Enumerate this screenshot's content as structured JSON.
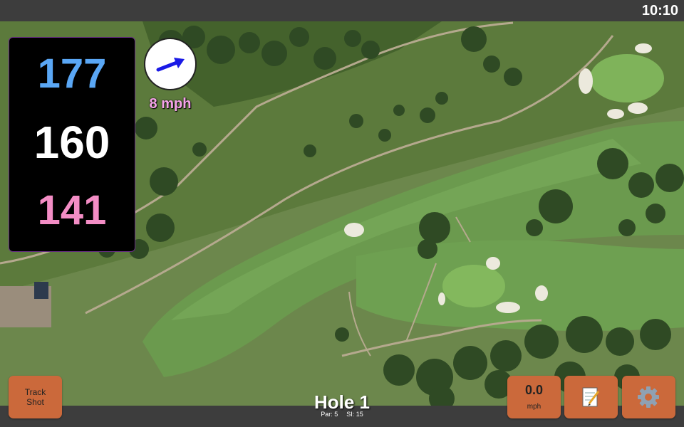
{
  "status_bar": {
    "time": "10:10"
  },
  "distances": {
    "back": "177",
    "middle": "160",
    "front": "141"
  },
  "wind": {
    "speed_label": "8 mph",
    "direction": "east-northeast"
  },
  "hole": {
    "title": "Hole 1",
    "par_label": "Par: 5",
    "si_label": "SI: 15"
  },
  "buttons": {
    "track_shot_line1": "Track",
    "track_shot_line2": "Shot",
    "wind_value": "0.0",
    "wind_unit": "mph",
    "notes_icon": "notepad-icon",
    "settings_icon": "gear-icon"
  },
  "colors": {
    "back_distance": "#5aa7f5",
    "middle_distance": "#ffffff",
    "front_distance": "#f38dc5",
    "button": "#cb693b",
    "wind_label": "#f6a3ea"
  }
}
